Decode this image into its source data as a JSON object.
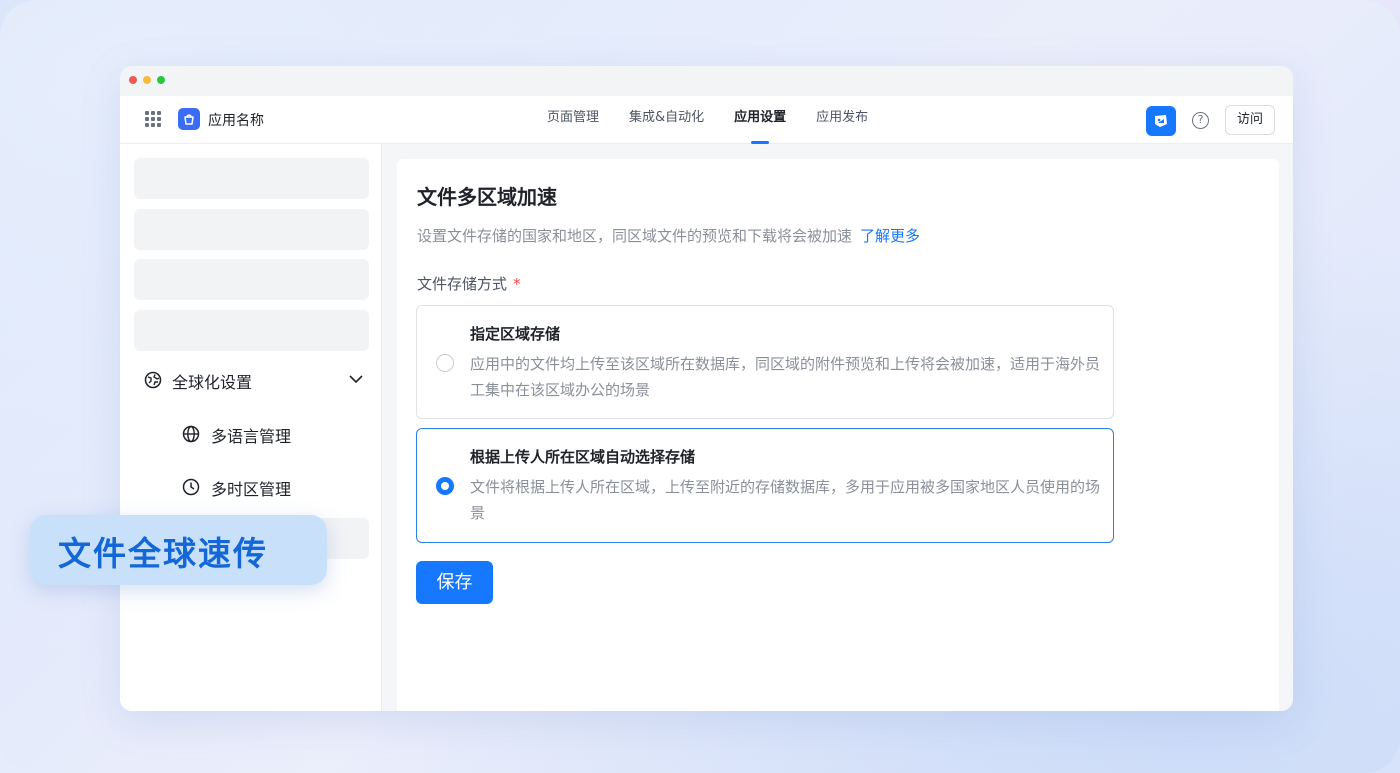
{
  "app": {
    "name": "应用名称",
    "brand_color": "#1677ff"
  },
  "nav": {
    "items": [
      {
        "label": "页面管理",
        "active": false
      },
      {
        "label": "集成&自动化",
        "active": false
      },
      {
        "label": "应用设置",
        "active": true
      },
      {
        "label": "应用发布",
        "active": false
      }
    ]
  },
  "header": {
    "help_icon": "question-icon",
    "visit_label": "访问"
  },
  "sidebar": {
    "group_label": "全球化设置",
    "items": [
      {
        "label": "多语言管理",
        "icon": "globe-icon"
      },
      {
        "label": "多时区管理",
        "icon": "clock-icon"
      }
    ]
  },
  "main": {
    "title": "文件多区域加速",
    "description": "设置文件存储的国家和地区，同区域文件的预览和下载将会被加速",
    "learn_more": "了解更多",
    "field_label": "文件存储方式",
    "required_mark": "*",
    "options": [
      {
        "title": "指定区域存储",
        "description": "应用中的文件均上传至该区域所在数据库，同区域的附件预览和上传将会被加速，适用于海外员工集中在该区域办公的场景",
        "selected": false
      },
      {
        "title": "根据上传人所在区域自动选择存储",
        "description": "文件将根据上传人所在区域，上传至附近的存储数据库，多用于应用被多国家地区人员使用的场景",
        "selected": true
      }
    ],
    "save_label": "保存"
  },
  "banner": {
    "text": "文件全球速传"
  }
}
